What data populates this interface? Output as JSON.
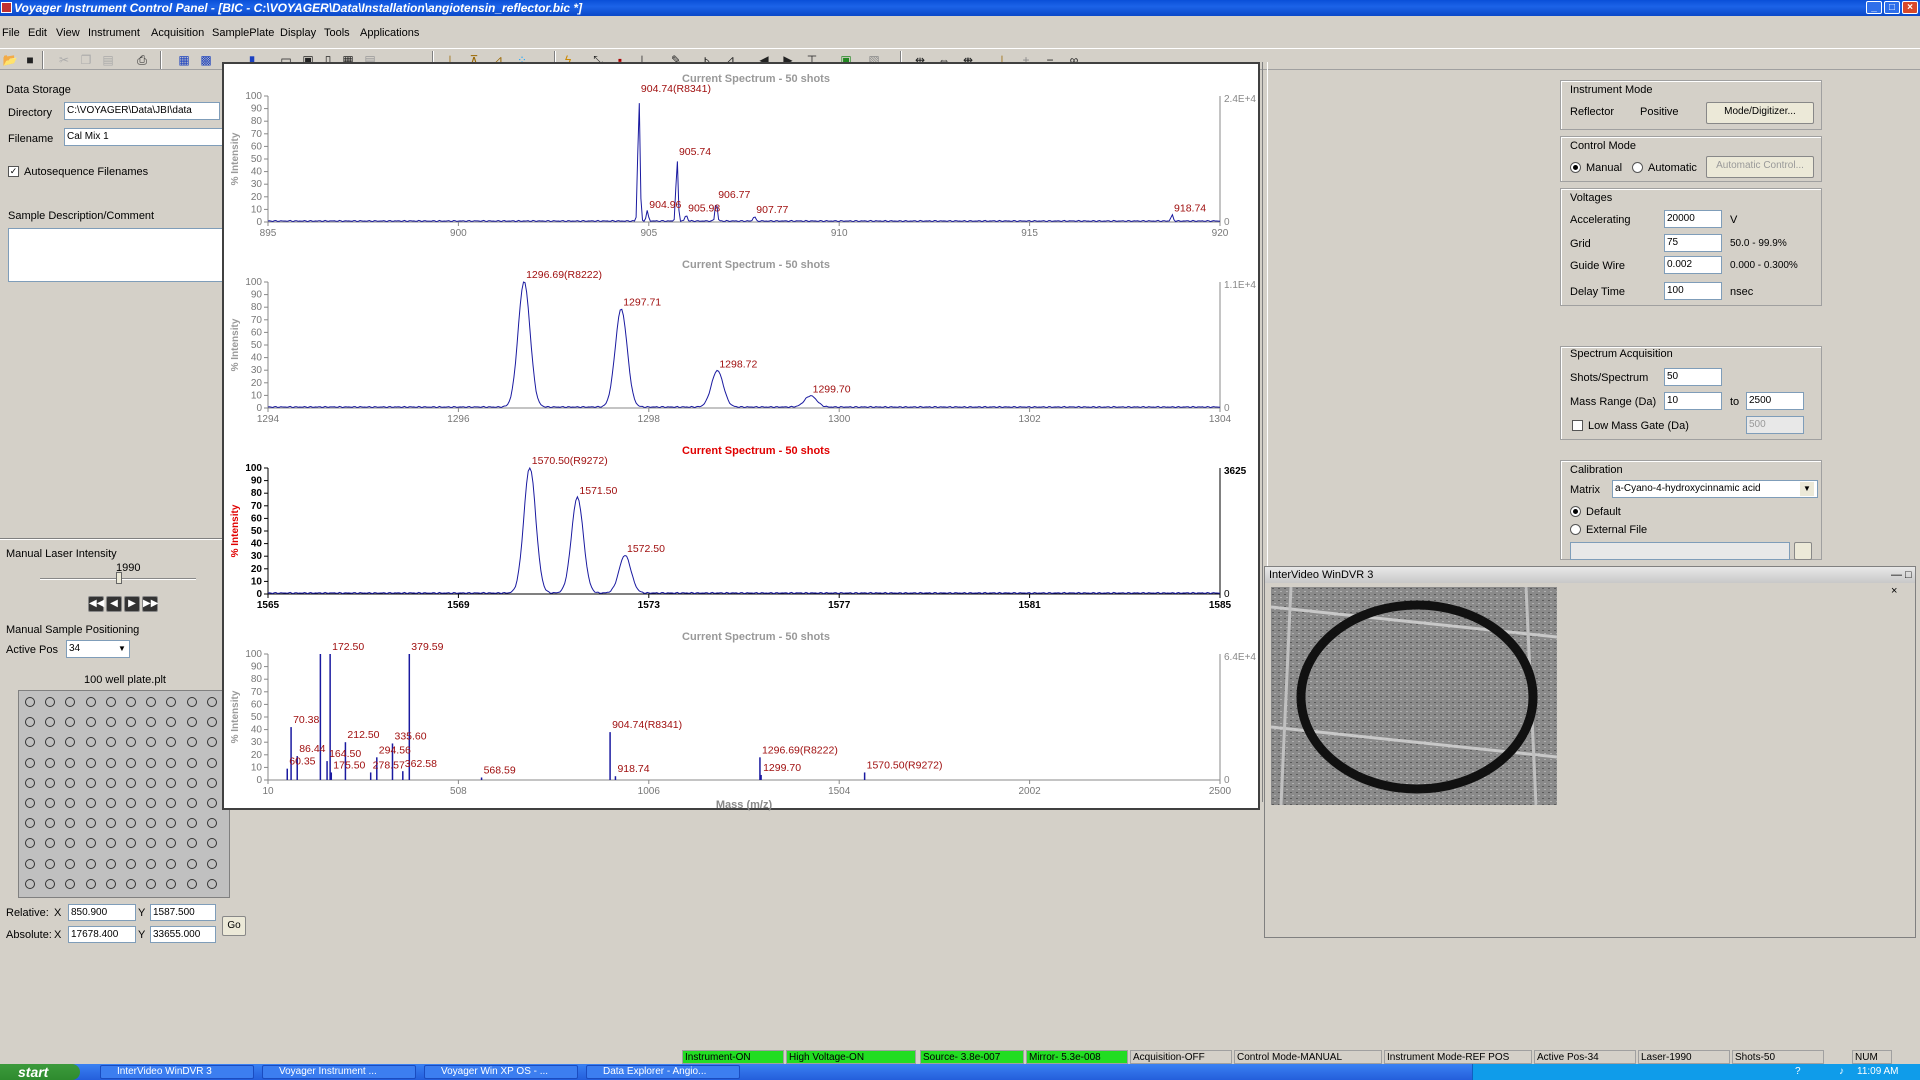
{
  "window": {
    "title": "Voyager Instrument Control Panel - [BIC - C:\\VOYAGER\\Data\\Installation\\angiotensin_reflector.bic *]"
  },
  "menu": [
    "File",
    "Edit",
    "View",
    "Instrument",
    "Acquisition",
    "SamplePlate",
    "Display",
    "Tools",
    "Applications"
  ],
  "data_storage": {
    "group_label": "Data Storage",
    "directory_label": "Directory",
    "directory_value": "C:\\VOYAGER\\Data\\JBI\\data",
    "browse_label": "...",
    "filename_label": "Filename",
    "filename_value": "Cal Mix 1",
    "autoseq_label": "Autosequence Filenames",
    "autoseq_checked": true,
    "desc_label": "Sample Description/Comment"
  },
  "laser": {
    "label": "Manual Laser Intensity",
    "value": "1990"
  },
  "sample_pos": {
    "label": "Manual Sample Positioning",
    "active_pos_label": "Active Pos",
    "active_pos_value": "34",
    "plate_name": "100 well plate.plt",
    "relative_label": "Relative:",
    "relative_x": "850.900",
    "relative_y": "1587.500",
    "absolute_label": "Absolute:",
    "absolute_x": "17678.400",
    "absolute_y": "33655.000",
    "x_label": "X",
    "y_label": "Y",
    "go_label": "Go"
  },
  "instrument_mode": {
    "group_label": "Instrument Mode",
    "mode": "Reflector",
    "polarity": "Positive",
    "button": "Mode/Digitizer..."
  },
  "control_mode": {
    "group_label": "Control Mode",
    "manual": "Manual",
    "automatic": "Automatic",
    "button": "Automatic Control..."
  },
  "voltages": {
    "group_label": "Voltages",
    "accelerating_label": "Accelerating",
    "accelerating_value": "20000",
    "accelerating_unit": "V",
    "grid_label": "Grid",
    "grid_value": "75",
    "grid_range": "50.0 - 99.9%",
    "guide_label": "Guide Wire",
    "guide_value": "0.002",
    "guide_range": "0.000 - 0.300%",
    "delay_label": "Delay Time",
    "delay_value": "100",
    "delay_unit": "nsec"
  },
  "spectrum_acq": {
    "group_label": "Spectrum Acquisition",
    "shots_label": "Shots/Spectrum",
    "shots_value": "50",
    "mass_label": "Mass Range (Da)",
    "mass_from": "10",
    "mass_to_label": "to",
    "mass_to": "2500",
    "low_gate_label": "Low Mass Gate (Da)",
    "low_gate_value": "500"
  },
  "calibration": {
    "group_label": "Calibration",
    "matrix_label": "Matrix",
    "matrix_value": "a-Cyano-4-hydroxycinnamic acid",
    "default_label": "Default",
    "external_label": "External File"
  },
  "dvr": {
    "title": "InterVideo WinDVR 3"
  },
  "status": [
    {
      "text": "Instrument-ON",
      "green": true
    },
    {
      "text": "High Voltage-ON",
      "green": true
    },
    {
      "text": "Source- 3.8e-007",
      "green": true
    },
    {
      "text": "Mirror- 5.3e-008",
      "green": true
    },
    {
      "text": "Acquisition-OFF",
      "green": false
    },
    {
      "text": "Control Mode-MANUAL",
      "green": false
    },
    {
      "text": "Instrument Mode-REF POS",
      "green": false
    },
    {
      "text": "Active Pos-34",
      "green": false
    },
    {
      "text": "Laser-1990",
      "green": false
    },
    {
      "text": "Shots-50",
      "green": false
    },
    {
      "text": "NUM",
      "green": false
    }
  ],
  "taskbar": {
    "start": "start",
    "tasks": [
      "InterVideo WinDVR 3",
      "Voyager Instrument ...",
      "Voyager Win XP OS - ...",
      "Data Explorer - Angio..."
    ],
    "clock": "11:09 AM"
  },
  "chart_data": [
    {
      "type": "line",
      "title": "Current Spectrum - 50 shots",
      "ylabel": "% Intensity",
      "xlim": [
        895,
        920
      ],
      "ylim": [
        0,
        100
      ],
      "xticks": [
        "895",
        "900",
        "905",
        "910",
        "915",
        "920"
      ],
      "yticks": [
        "0",
        "10",
        "20",
        "30",
        "40",
        "50",
        "60",
        "70",
        "80",
        "90",
        "100"
      ],
      "right_max": "2.4E+4",
      "right_min": "0",
      "peaks": [
        {
          "x": 904.74,
          "y": 100,
          "label": "904.74(R8341)"
        },
        {
          "x": 904.96,
          "y": 8,
          "label": "904.96"
        },
        {
          "x": 905.74,
          "y": 50,
          "label": "905.74"
        },
        {
          "x": 905.98,
          "y": 5,
          "label": "905.98"
        },
        {
          "x": 906.77,
          "y": 16,
          "label": "906.77"
        },
        {
          "x": 907.77,
          "y": 4,
          "label": "907.77"
        },
        {
          "x": 918.74,
          "y": 5,
          "label": "918.74"
        }
      ]
    },
    {
      "type": "line",
      "title": "Current Spectrum - 50 shots",
      "ylabel": "% Intensity",
      "xlim": [
        1294,
        1304
      ],
      "ylim": [
        0,
        100
      ],
      "xticks": [
        "1294",
        "1296",
        "1298",
        "1300",
        "1302",
        "1304"
      ],
      "yticks": [
        "0",
        "10",
        "20",
        "30",
        "40",
        "50",
        "60",
        "70",
        "80",
        "90",
        "100"
      ],
      "right_max": "1.1E+4",
      "right_min": "0",
      "peaks": [
        {
          "x": 1296.69,
          "y": 100,
          "label": "1296.69(R8222)"
        },
        {
          "x": 1297.71,
          "y": 78,
          "label": "1297.71"
        },
        {
          "x": 1298.72,
          "y": 29,
          "label": "1298.72"
        },
        {
          "x": 1299.7,
          "y": 9,
          "label": "1299.70"
        }
      ]
    },
    {
      "type": "line",
      "title": "Current Spectrum - 50 shots",
      "active": true,
      "ylabel": "% Intensity",
      "xlim": [
        1565,
        1585
      ],
      "ylim": [
        0,
        100
      ],
      "xticks": [
        "1565",
        "1569",
        "1573",
        "1577",
        "1581",
        "1585"
      ],
      "yticks": [
        "0",
        "10",
        "20",
        "30",
        "40",
        "50",
        "60",
        "70",
        "80",
        "90",
        "100"
      ],
      "right_max": "3625",
      "right_min": "0",
      "peaks": [
        {
          "x": 1570.5,
          "y": 100,
          "label": "1570.50(R9272)"
        },
        {
          "x": 1571.5,
          "y": 76,
          "label": "1571.50"
        },
        {
          "x": 1572.5,
          "y": 30,
          "label": "1572.50"
        }
      ]
    },
    {
      "type": "bar",
      "title": "Current Spectrum - 50 shots",
      "ylabel": "% Intensity",
      "xlabel": "Mass (m/z)",
      "xlim": [
        10,
        2500
      ],
      "ylim": [
        0,
        100
      ],
      "xticks": [
        "10",
        "508",
        "1006",
        "1504",
        "2002",
        "2500"
      ],
      "yticks": [
        "0",
        "10",
        "20",
        "30",
        "40",
        "50",
        "60",
        "70",
        "80",
        "90",
        "100"
      ],
      "right_max": "6.4E+4",
      "right_min": "0",
      "peaks": [
        {
          "x": 60.35,
          "y": 9,
          "label": "60.35"
        },
        {
          "x": 70.38,
          "y": 42,
          "label": "70.38"
        },
        {
          "x": 86.44,
          "y": 19,
          "label": "86.44"
        },
        {
          "x": 147.0,
          "y": 100,
          "label": ""
        },
        {
          "x": 164.5,
          "y": 15,
          "label": "164.50"
        },
        {
          "x": 172.5,
          "y": 100,
          "label": "172.50"
        },
        {
          "x": 175.5,
          "y": 6,
          "label": "175.50"
        },
        {
          "x": 212.5,
          "y": 30,
          "label": "212.50"
        },
        {
          "x": 278.57,
          "y": 6,
          "label": "278.57"
        },
        {
          "x": 294.56,
          "y": 18,
          "label": "294.56"
        },
        {
          "x": 335.6,
          "y": 29,
          "label": "335.60"
        },
        {
          "x": 362.58,
          "y": 7,
          "label": "362.58"
        },
        {
          "x": 379.59,
          "y": 100,
          "label": "379.59"
        },
        {
          "x": 568.59,
          "y": 2,
          "label": "568.59"
        },
        {
          "x": 904.74,
          "y": 38,
          "label": "904.74(R8341)"
        },
        {
          "x": 918.74,
          "y": 3,
          "label": "918.74"
        },
        {
          "x": 1296.69,
          "y": 18,
          "label": "1296.69(R8222)"
        },
        {
          "x": 1299.7,
          "y": 4,
          "label": "1299.70"
        },
        {
          "x": 1570.5,
          "y": 6,
          "label": "1570.50(R9272)"
        }
      ]
    }
  ]
}
